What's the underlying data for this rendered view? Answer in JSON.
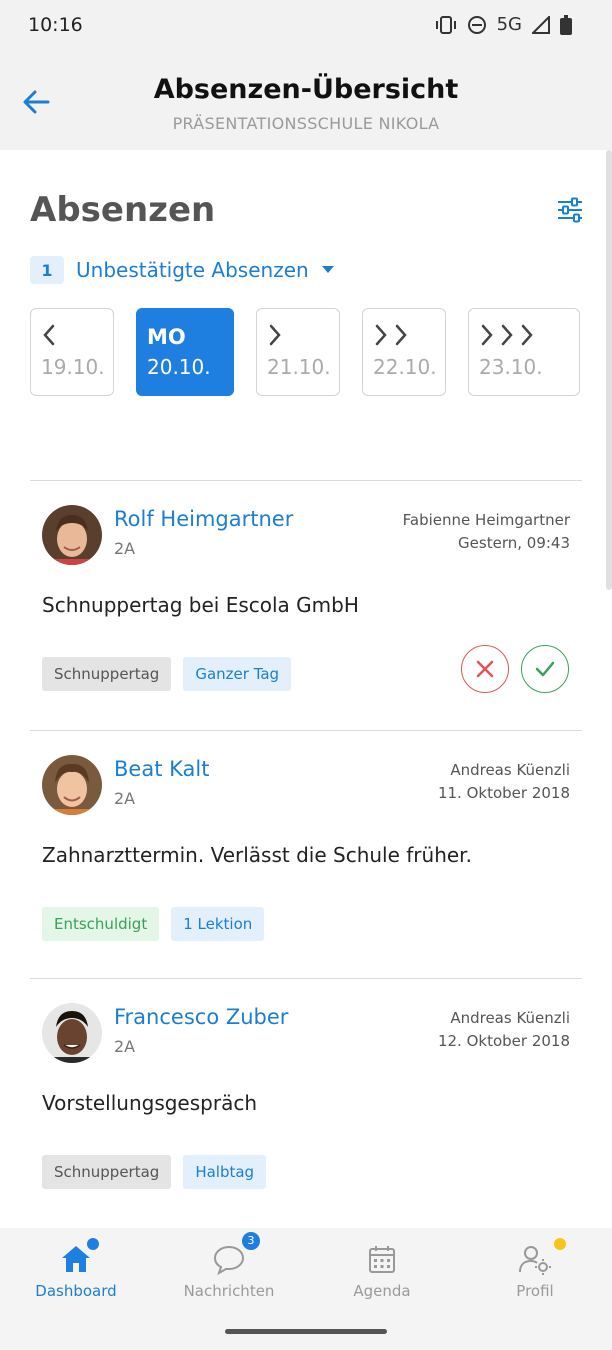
{
  "status_bar": {
    "time": "10:16",
    "network": "5G"
  },
  "app_bar": {
    "title": "Absenzen-Übersicht",
    "subtitle": "PRÄSENTATIONSSCHULE NIKOLA"
  },
  "section": {
    "title": "Absenzen"
  },
  "unconfirmed": {
    "count": "1",
    "label": "Unbestätigte Absenzen"
  },
  "days": [
    {
      "dow": "",
      "date": "19.10.",
      "active": false,
      "arrows": "prev-1"
    },
    {
      "dow": "MO",
      "date": "20.10.",
      "active": true,
      "arrows": "none"
    },
    {
      "dow": "",
      "date": "21.10.",
      "active": false,
      "arrows": "next-1"
    },
    {
      "dow": "",
      "date": "22.10.",
      "active": false,
      "arrows": "next-2"
    },
    {
      "dow": "",
      "date": "23.10.",
      "active": false,
      "arrows": "next-3"
    }
  ],
  "absences": [
    {
      "student": "Rolf Heimgartner",
      "class": "2A",
      "reporter": "Fabienne Heimgartner",
      "reported_at": "Gestern, 09:43",
      "reason": "Schnuppertag bei Escola GmbH",
      "tags": [
        "Schnuppertag",
        "Ganzer Tag"
      ],
      "has_actions": true
    },
    {
      "student": "Beat Kalt",
      "class": "2A",
      "reporter": "Andreas Küenzli",
      "reported_at": "11. Oktober 2018",
      "reason": "Zahnarzttermin. Verlässt die Schule früher.",
      "tags": [
        "Entschuldigt",
        "1 Lektion"
      ],
      "has_actions": false
    },
    {
      "student": "Francesco Zuber",
      "class": "2A",
      "reporter": "Andreas Küenzli",
      "reported_at": "12. Oktober 2018",
      "reason": "Vorstellungsgespräch",
      "tags": [
        "Schnuppertag",
        "Halbtag"
      ],
      "has_actions": false
    }
  ],
  "bottom_nav": [
    {
      "label": "Dashboard",
      "icon": "home-icon",
      "active": true
    },
    {
      "label": "Nachrichten",
      "icon": "chat-icon",
      "active": false,
      "badge": "3"
    },
    {
      "label": "Agenda",
      "icon": "calendar-icon",
      "active": false
    },
    {
      "label": "Profil",
      "icon": "profile-settings-icon",
      "active": false
    }
  ],
  "colors": {
    "accent": "#1f7fe0",
    "link": "#1a7fd4",
    "reject": "#e05555",
    "confirm": "#3aa05b",
    "badge_yellow": "#f5c518"
  }
}
